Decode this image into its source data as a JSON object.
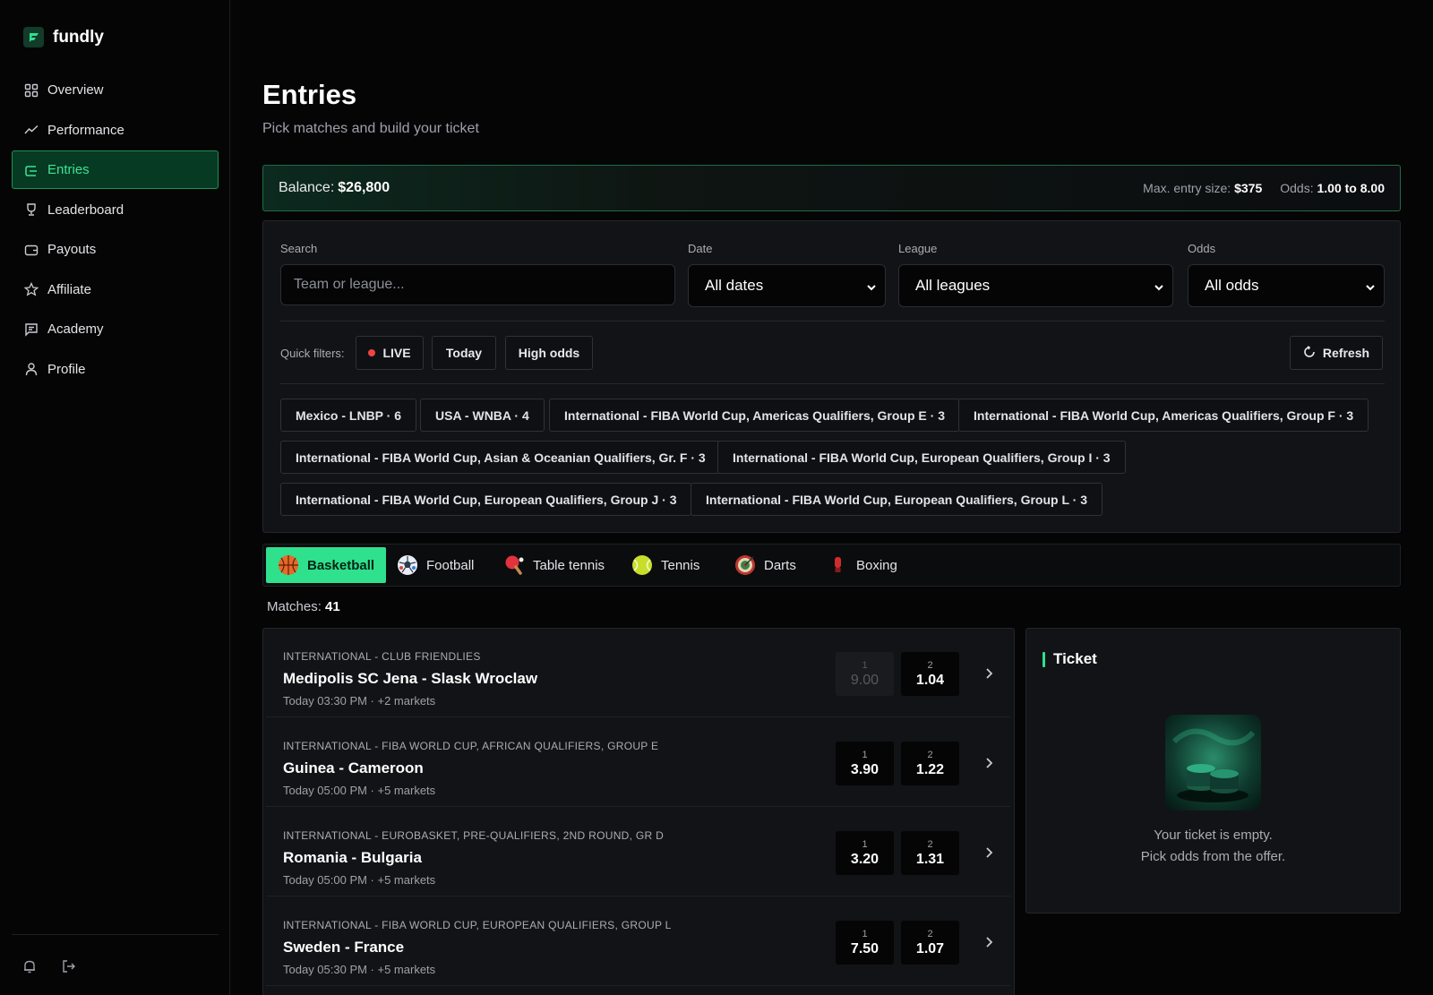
{
  "brand": {
    "name": "fundly"
  },
  "nav": {
    "items": [
      {
        "label": "Overview",
        "icon": "grid-icon"
      },
      {
        "label": "Performance",
        "icon": "trend-icon"
      },
      {
        "label": "Entries",
        "icon": "entries-icon",
        "active": true
      },
      {
        "label": "Leaderboard",
        "icon": "trophy-icon"
      },
      {
        "label": "Payouts",
        "icon": "wallet-icon"
      },
      {
        "label": "Affiliate",
        "icon": "star-icon"
      },
      {
        "label": "Academy",
        "icon": "chat-icon"
      },
      {
        "label": "Profile",
        "icon": "user-icon"
      }
    ]
  },
  "page": {
    "title": "Entries",
    "subtitle": "Pick matches and build your ticket"
  },
  "balance": {
    "label": "Balance:",
    "value": "$26,800",
    "max_entry_label": "Max. entry size:",
    "max_entry_value": "$375",
    "odds_label": "Odds:",
    "odds_value": "1.00 to 8.00"
  },
  "filters": {
    "search_label": "Search",
    "search_placeholder": "Team or league...",
    "date_label": "Date",
    "date_value": "All dates",
    "league_label": "League",
    "league_value": "All leagues",
    "odds_label": "Odds",
    "odds_value": "All odds",
    "quick_label": "Quick filters:",
    "quick": {
      "live": "LIVE",
      "today": "Today",
      "high": "High odds"
    },
    "refresh": "Refresh",
    "leagues": [
      "Mexico - LNBP · 6",
      "USA - WNBA · 4",
      "International - FIBA World Cup, Americas Qualifiers, Group E · 3",
      "International - FIBA World Cup, Americas Qualifiers, Group F · 3",
      "International - FIBA World Cup, Asian & Oceanian Qualifiers, Gr. F · 3",
      "International - FIBA World Cup, European Qualifiers, Group I · 3",
      "International - FIBA World Cup, European Qualifiers, Group J · 3",
      "International - FIBA World Cup, European Qualifiers, Group L · 3"
    ]
  },
  "sports": [
    {
      "label": "Basketball",
      "icon": "basketball-icon",
      "active": true
    },
    {
      "label": "Football",
      "icon": "football-icon"
    },
    {
      "label": "Table tennis",
      "icon": "table-tennis-icon"
    },
    {
      "label": "Tennis",
      "icon": "tennis-ball-icon"
    },
    {
      "label": "Darts",
      "icon": "dartboard-icon"
    },
    {
      "label": "Boxing",
      "icon": "boxing-glove-icon"
    }
  ],
  "matches_label": "Matches:",
  "matches_count": "41",
  "matches": [
    {
      "league": "INTERNATIONAL - CLUB FRIENDLIES",
      "teams": "Medipolis SC Jena - Slask Wroclaw",
      "time": "Today 03:30 PM · +2 markets",
      "o1_label": "1",
      "o1": "9.00",
      "o1_disabled": true,
      "o2_label": "2",
      "o2": "1.04"
    },
    {
      "league": "INTERNATIONAL - FIBA WORLD CUP, AFRICAN QUALIFIERS, GROUP E",
      "teams": "Guinea - Cameroon",
      "time": "Today 05:00 PM · +5 markets",
      "o1_label": "1",
      "o1": "3.90",
      "o2_label": "2",
      "o2": "1.22"
    },
    {
      "league": "INTERNATIONAL - EUROBASKET, PRE-QUALIFIERS, 2ND ROUND, GR D",
      "teams": "Romania - Bulgaria",
      "time": "Today 05:00 PM · +5 markets",
      "o1_label": "1",
      "o1": "3.20",
      "o2_label": "2",
      "o2": "1.31"
    },
    {
      "league": "INTERNATIONAL - FIBA WORLD CUP, EUROPEAN QUALIFIERS, GROUP L",
      "teams": "Sweden - France",
      "time": "Today 05:30 PM · +5 markets",
      "o1_label": "1",
      "o1": "7.50",
      "o2_label": "2",
      "o2": "1.07"
    }
  ],
  "ticket": {
    "title": "Ticket",
    "empty_line1": "Your ticket is empty.",
    "empty_line2": "Pick odds from the offer."
  },
  "colors": {
    "accent": "#2fe08d",
    "live": "#ef4444",
    "background": "#050506",
    "panel": "#121316"
  }
}
